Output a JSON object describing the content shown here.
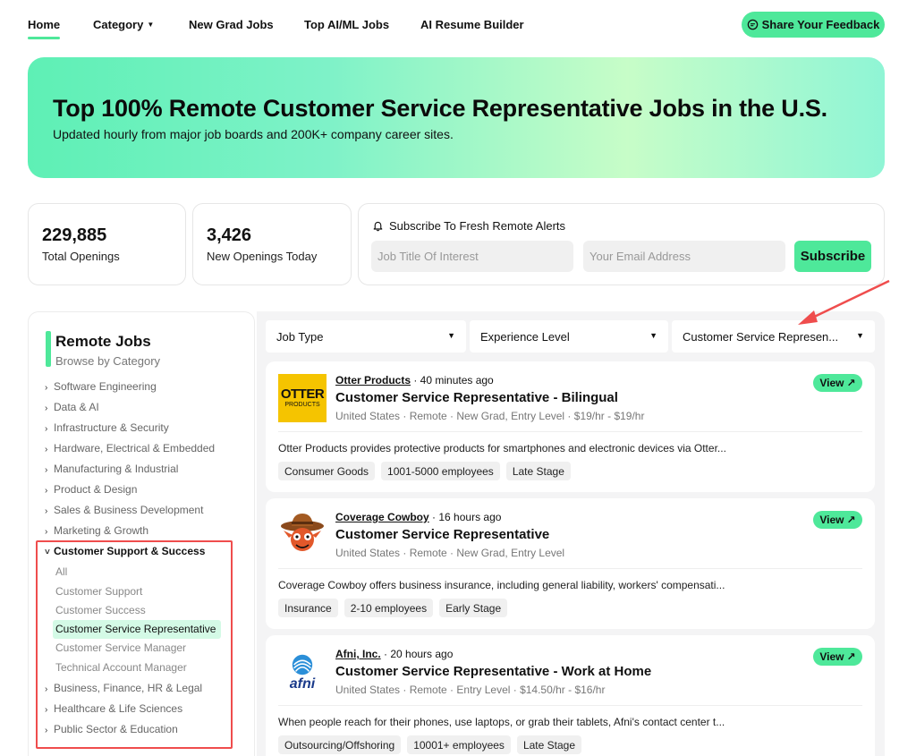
{
  "nav": {
    "home": "Home",
    "category": "Category",
    "new_grad": "New Grad Jobs",
    "top_ai": "Top AI/ML Jobs",
    "resume": "AI Resume Builder",
    "feedback": "Share Your Feedback"
  },
  "hero": {
    "title": "Top 100% Remote Customer Service Representative Jobs in the U.S.",
    "subtitle": "Updated hourly from major job boards and 200K+ company career sites."
  },
  "stats": [
    {
      "value": "229,885",
      "label": "Total Openings"
    },
    {
      "value": "3,426",
      "label": "New Openings Today"
    }
  ],
  "subscribe": {
    "title": "Subscribe To Fresh Remote Alerts",
    "job_placeholder": "Job Title Of Interest",
    "email_placeholder": "Your Email Address",
    "button": "Subscribe"
  },
  "sidebar": {
    "title": "Remote Jobs",
    "subtitle": "Browse by Category",
    "categories": [
      "Software Engineering",
      "Data & AI",
      "Infrastructure & Security",
      "Hardware, Electrical & Embedded",
      "Manufacturing & Industrial",
      "Product & Design",
      "Sales & Business Development",
      "Marketing & Growth",
      "Customer Support & Success"
    ],
    "subcategories": [
      "All",
      "Customer Support",
      "Customer Success",
      "Customer Service Representative",
      "Customer Service Manager",
      "Technical Account Manager"
    ],
    "categories_after": [
      "Business, Finance, HR & Legal",
      "Healthcare & Life Sciences",
      "Public Sector & Education"
    ]
  },
  "filters": {
    "job_type": "Job Type",
    "experience": "Experience Level",
    "role": "Customer Service Represen..."
  },
  "jobs": [
    {
      "company": "Otter Products",
      "posted": " · 40 minutes ago",
      "title": "Customer Service Representative - Bilingual",
      "meta": "United States · Remote · New Grad, Entry Level · $19/hr - $19/hr",
      "desc": "Otter Products provides protective products for smartphones and electronic devices via Otter...",
      "tags": [
        "Consumer Goods",
        "1001-5000 employees",
        "Late Stage"
      ],
      "logo_text_1": "OTTER",
      "logo_text_2": "PRODUCTS",
      "view": "View"
    },
    {
      "company": "Coverage Cowboy",
      "posted": " · 16 hours ago",
      "title": "Customer Service Representative",
      "meta": "United States · Remote · New Grad, Entry Level",
      "desc": "Coverage Cowboy offers business insurance, including general liability, workers' compensati...",
      "tags": [
        "Insurance",
        "2-10 employees",
        "Early Stage"
      ],
      "view": "View"
    },
    {
      "company": "Afni, Inc.",
      "posted": " · 20 hours ago",
      "title": "Customer Service Representative - Work at Home",
      "meta": "United States · Remote · Entry Level · $14.50/hr - $16/hr",
      "desc": "When people reach for their phones, use laptops, or grab their tablets, Afni's contact center t...",
      "tags": [
        "Outsourcing/Offshoring",
        "10001+ employees",
        "Late Stage"
      ],
      "logo_text": "afni",
      "view": "View"
    }
  ],
  "colors": {
    "accent": "#4ee89a",
    "highlight": "#d4fae6",
    "annotation": "#ef4d4d"
  }
}
